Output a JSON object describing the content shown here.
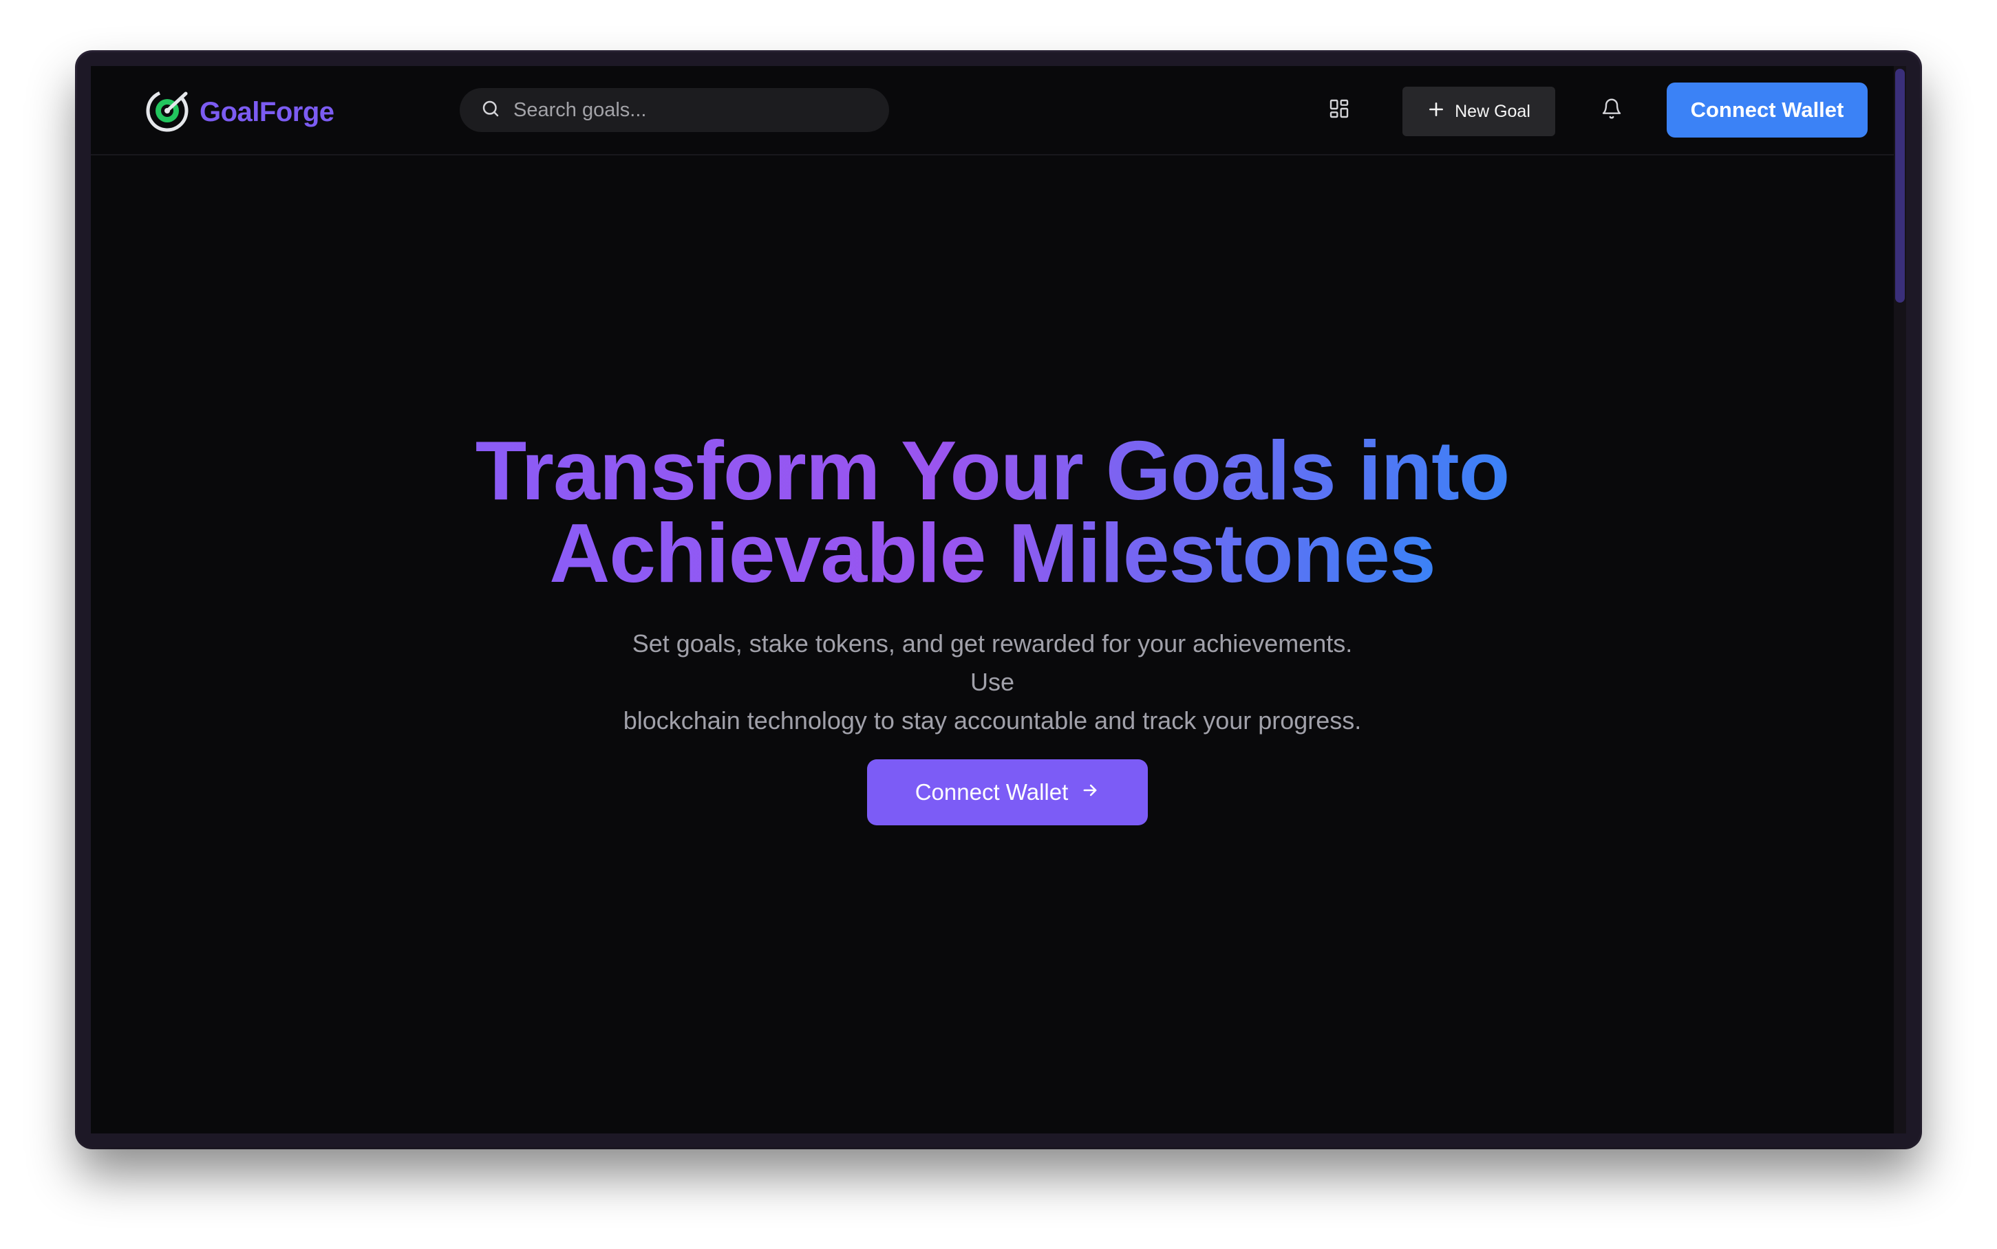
{
  "app": {
    "name": "GoalForge",
    "brand_color": "#7c5cf2"
  },
  "navbar": {
    "search_placeholder": "Search goals...",
    "dashboard_icon": "layout-grid-icon",
    "community_icon": "users-icon",
    "new_goal_label": "New Goal",
    "notifications_icon": "bell-icon",
    "connect_wallet_label": "Connect Wallet",
    "connect_wallet_color": "#3b82f6"
  },
  "hero": {
    "title_line1": "Transform Your Goals into",
    "title_line2": "Achievable Milestones",
    "subtitle_line1": "Set goals, stake tokens, and get rewarded for your achievements. Use",
    "subtitle_line2": "blockchain technology to stay accountable and track your progress.",
    "cta_label": "Connect Wallet",
    "cta_icon": "arrow-right-icon",
    "cta_color": "#7c5cf6"
  }
}
